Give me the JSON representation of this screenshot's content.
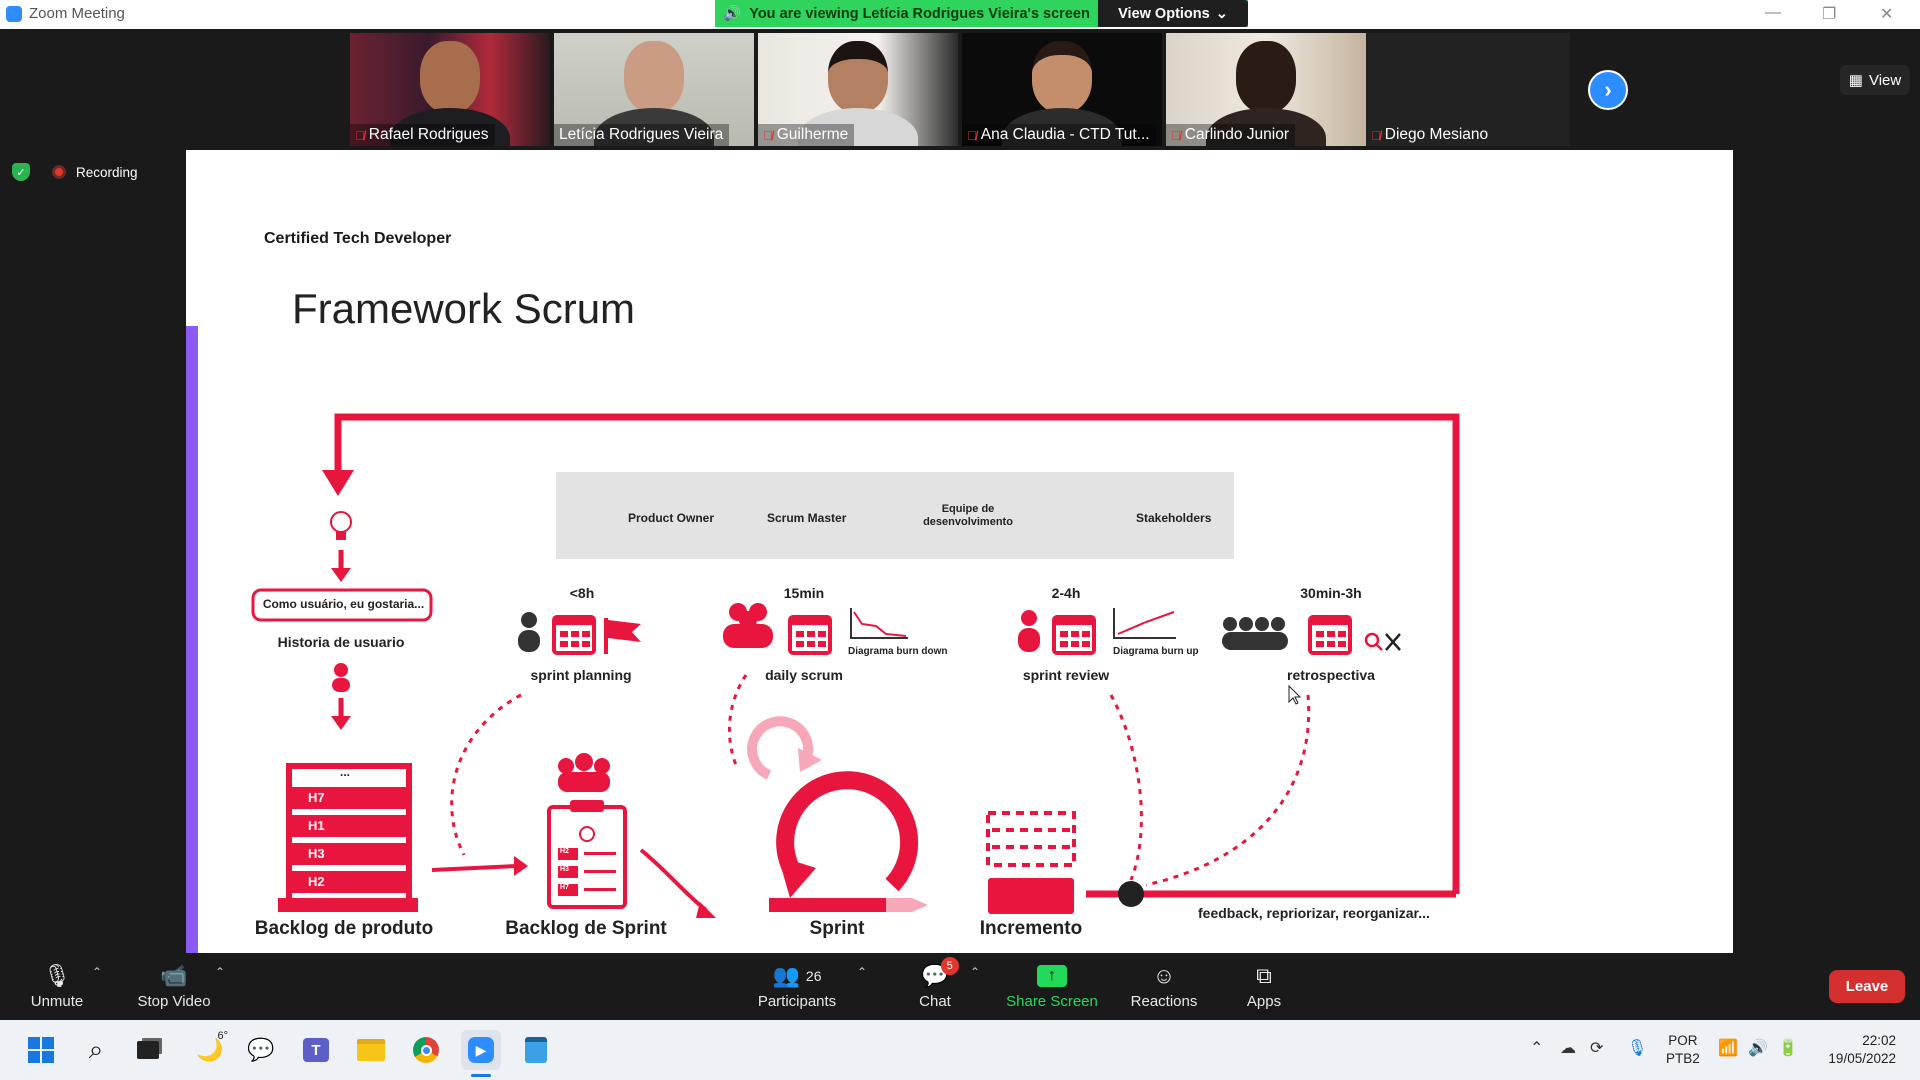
{
  "window": {
    "title": "Zoom Meeting"
  },
  "banner": {
    "message": "You are viewing Letícia Rodrigues Vieira's screen",
    "view_options": "View Options"
  },
  "participants_strip": [
    {
      "name": "Rafael Rodrigues",
      "muted": true
    },
    {
      "name": "Letícia Rodrigues Vieira",
      "muted": false,
      "active": true
    },
    {
      "name": "Guilherme",
      "muted": true
    },
    {
      "name": "Ana Claudia - CTD Tut...",
      "muted": true
    },
    {
      "name": "Carlindo  Junior",
      "muted": true
    },
    {
      "name": "Diego Mesiano",
      "muted": true,
      "video_off": true
    }
  ],
  "view_button": "View",
  "recording": {
    "label": "Recording"
  },
  "slide": {
    "brand": "Certified Tech Developer",
    "title": "Framework Scrum",
    "legend": {
      "product_owner": "Product Owner",
      "scrum_master": "Scrum Master",
      "team_line1": "Equipe de",
      "team_line2": "desenvolvimento",
      "stakeholders": "Stakeholders"
    },
    "user_story_box": "Como usuário, eu gostaria...",
    "user_story_label": "Historia de usuario",
    "events": [
      {
        "duration": "<8h",
        "label": "sprint planning"
      },
      {
        "duration": "15min",
        "label": "daily scrum",
        "chart": "Diagrama burn down"
      },
      {
        "duration": "2-4h",
        "label": "sprint review",
        "chart": "Diagrama burn up"
      },
      {
        "duration": "30min-3h",
        "label": "retrospectiva"
      }
    ],
    "backlog_items": [
      "H7",
      "H1",
      "H3",
      "H2"
    ],
    "sprint_items": [
      "H2",
      "H3",
      "H7"
    ],
    "backlog_ellipsis": "...",
    "artifacts": {
      "product_backlog": "Backlog de produto",
      "sprint_backlog": "Backlog de Sprint",
      "sprint": "Sprint",
      "increment": "Incremento"
    },
    "feedback": "feedback, repriorizar, reorganizar..."
  },
  "toolbar": {
    "unmute": "Unmute",
    "stop_video": "Stop Video",
    "participants": "Participants",
    "participants_count": "26",
    "chat": "Chat",
    "chat_badge": "5",
    "share_screen": "Share Screen",
    "reactions": "Reactions",
    "apps": "Apps",
    "leave": "Leave"
  },
  "taskbar": {
    "weather": "6°",
    "lang_line1": "POR",
    "lang_line2": "PTB2",
    "time": "22:02",
    "date": "19/05/2022"
  },
  "colors": {
    "accent_red": "#e8163f",
    "zoom_blue": "#2d8cff",
    "share_green": "#23d959",
    "leave_red": "#d32f2f",
    "slide_purple": "#8a5cf5"
  }
}
